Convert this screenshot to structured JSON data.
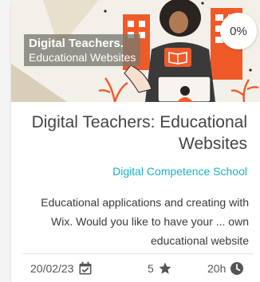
{
  "course": {
    "image_title_line1": "Digital Teachers.",
    "image_title_line2": "Educational Websites",
    "progress": "0%",
    "title": "Digital Teachers: Educational Websites",
    "school": "Digital Competence School",
    "description": "Educational applications and creating with Wix.  Would you like to have your ... own educational website",
    "date": "20/02/23",
    "rating": "5",
    "duration": "20h"
  },
  "icons": {
    "date": "calendar-check-icon",
    "rating": "star-icon",
    "duration": "clock-icon"
  },
  "colors": {
    "accent": "#19b3c8",
    "illustration_orange": "#f05a28"
  }
}
